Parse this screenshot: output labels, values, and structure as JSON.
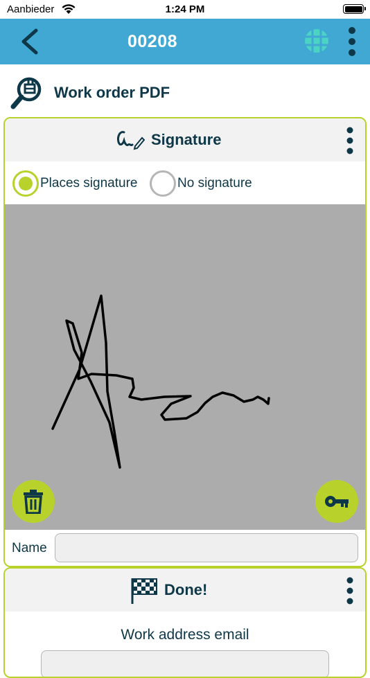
{
  "status_bar": {
    "carrier": "Aanbieder",
    "time": "1:24 PM"
  },
  "app_bar": {
    "title": "00208"
  },
  "page_header": {
    "title": "Work order PDF"
  },
  "signature_card": {
    "title": "Signature",
    "options": [
      {
        "label": "Places signature",
        "selected": true
      },
      {
        "label": "No signature",
        "selected": false
      }
    ],
    "name_label": "Name",
    "name_value": ""
  },
  "done_card": {
    "title": "Done!",
    "email_label": "Work address email",
    "email_value": ""
  },
  "colors": {
    "app_bar": "#41a7d3",
    "accent": "#b8d12b",
    "text": "#0e3747",
    "globe": "#4bd3c4",
    "signature_pad": "#acacac"
  }
}
